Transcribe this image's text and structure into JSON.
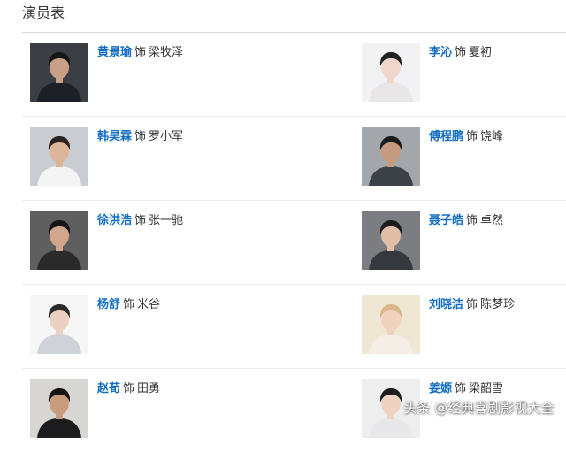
{
  "section": {
    "title": "演员表"
  },
  "cast": [
    {
      "left": {
        "actor": "黄景瑜",
        "sep": "饰",
        "role": "梁牧泽",
        "photo": {
          "bg": "#3b3f44",
          "skin": "#c99f86",
          "hair": "#161616",
          "top": "#1d2127"
        }
      },
      "right": {
        "actor": "李沁",
        "sep": "饰",
        "role": "夏初",
        "photo": {
          "bg": "#f2f2f4",
          "skin": "#f1d7cb",
          "hair": "#222222",
          "top": "#e9e6e8"
        }
      }
    },
    {
      "left": {
        "actor": "韩昊霖",
        "sep": "饰",
        "role": "罗小军",
        "photo": {
          "bg": "#c9ccd0",
          "skin": "#ddb59a",
          "hair": "#2a2320",
          "top": "#f4f4f4"
        }
      },
      "right": {
        "actor": "傅程鹏",
        "sep": "饰",
        "role": "饶峰",
        "photo": {
          "bg": "#a3a6aa",
          "skin": "#c69a7e",
          "hair": "#1a1a1a",
          "top": "#3c4148"
        }
      }
    },
    {
      "left": {
        "actor": "徐洪浩",
        "sep": "饰",
        "role": "张一驰",
        "photo": {
          "bg": "#5f5f5f",
          "skin": "#d1a68a",
          "hair": "#151515",
          "top": "#2a2a2a"
        }
      },
      "right": {
        "actor": "聂子皓",
        "sep": "饰",
        "role": "卓然",
        "photo": {
          "bg": "#7b7d80",
          "skin": "#e0bea8",
          "hair": "#1b1b1b",
          "top": "#35383d"
        }
      }
    },
    {
      "left": {
        "actor": "杨舒",
        "sep": "饰",
        "role": "米谷",
        "photo": {
          "bg": "#f6f6f6",
          "skin": "#ecd0c1",
          "hair": "#2b2b2b",
          "top": "#cfd3d8"
        }
      },
      "right": {
        "actor": "刘晓洁",
        "sep": "饰",
        "role": "陈梦珍",
        "photo": {
          "bg": "#efe6d4",
          "skin": "#f0d2bf",
          "hair": "#d9b78a",
          "top": "#f4eee6"
        }
      }
    },
    {
      "left": {
        "actor": "赵荀",
        "sep": "饰",
        "role": "田勇",
        "photo": {
          "bg": "#d8d6d2",
          "skin": "#c99c80",
          "hair": "#151515",
          "top": "#1c1c1e"
        }
      },
      "right": {
        "actor": "姜嫄",
        "sep": "饰",
        "role": "梁韶雪",
        "photo": {
          "bg": "#eeeeef",
          "skin": "#efd2c2",
          "hair": "#1e1e1e",
          "top": "#e8e8ea"
        }
      }
    }
  ],
  "watermark": "头条 @经典喜剧影视大全"
}
